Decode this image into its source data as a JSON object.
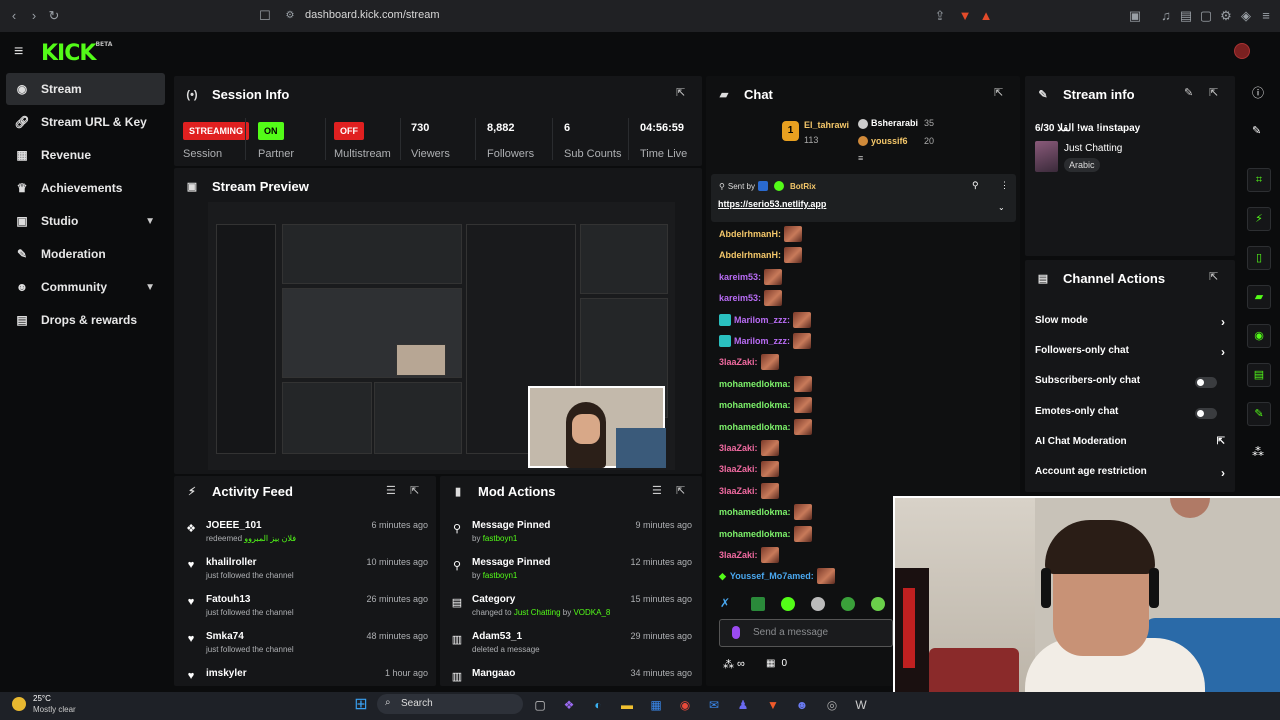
{
  "browser": {
    "url": "dashboard.kick.com/stream"
  },
  "logo": {
    "text": "KICK",
    "tag": "BETA"
  },
  "sidebar": {
    "items": [
      {
        "label": "Stream",
        "icon": "broadcast-icon"
      },
      {
        "label": "Stream URL & Key",
        "icon": "link-icon"
      },
      {
        "label": "Revenue",
        "icon": "revenue-icon"
      },
      {
        "label": "Achievements",
        "icon": "trophy-icon"
      },
      {
        "label": "Studio",
        "icon": "studio-icon"
      },
      {
        "label": "Moderation",
        "icon": "wrench-icon"
      },
      {
        "label": "Community",
        "icon": "community-icon"
      },
      {
        "label": "Drops & rewards",
        "icon": "gift-icon"
      }
    ]
  },
  "session": {
    "title": "Session Info",
    "status_badge": "STREAMING",
    "status_label": "Session",
    "partner_badge": "ON",
    "partner_label": "Partner",
    "multistream_badge": "OFF",
    "multistream_label": "Multistream",
    "viewers": "730",
    "viewers_label": "Viewers",
    "followers": "8,882",
    "followers_label": "Followers",
    "subs": "6",
    "subs_label": "Sub Counts",
    "time": "04:56:59",
    "time_label": "Time Live"
  },
  "preview": {
    "title": "Stream Preview"
  },
  "activity": {
    "title": "Activity Feed",
    "items": [
      {
        "name": "JOEEE_101",
        "sub": "redeemed",
        "reward": "فلان بيز المبروو",
        "time": "6 minutes ago"
      },
      {
        "name": "khalilroller",
        "sub": "just followed the channel",
        "time": "10 minutes ago"
      },
      {
        "name": "Fatouh13",
        "sub": "just followed the channel",
        "time": "26 minutes ago"
      },
      {
        "name": "Smka74",
        "sub": "just followed the channel",
        "time": "48 minutes ago"
      },
      {
        "name": "imskyler",
        "sub": "",
        "time": "1 hour ago"
      }
    ]
  },
  "modactions": {
    "title": "Mod Actions",
    "items": [
      {
        "name": "Message Pinned",
        "pre": "by",
        "by": "fastboyn1",
        "time": "9 minutes ago"
      },
      {
        "name": "Message Pinned",
        "pre": "by",
        "by": "fastboyn1",
        "time": "12 minutes ago"
      },
      {
        "name": "Category",
        "pre": "changed to",
        "cat": "Just Chatting",
        "by2": "by",
        "user": "VODKA_8",
        "time": "15 minutes ago"
      },
      {
        "name": "Adam53_1",
        "pre": "deleted a message",
        "time": "29 minutes ago"
      },
      {
        "name": "Mangaao",
        "pre": "",
        "time": "34 minutes ago"
      }
    ]
  },
  "chat": {
    "title": "Chat",
    "top": [
      {
        "name": "El_tahrawi",
        "count": "113"
      },
      {
        "name": "Bsherarabi",
        "count": "35"
      },
      {
        "name": "youssif6",
        "count": "20"
      }
    ],
    "pinned": {
      "sent_by": "Sent by",
      "bot": "BotRix",
      "link": "https://serio53.netlify.app"
    },
    "messages": [
      {
        "user": "AbdelrhmanH:",
        "color": "#f4c76a"
      },
      {
        "user": "AbdelrhmanH:",
        "color": "#f4c76a"
      },
      {
        "user": "kareim53:",
        "color": "#b86cf4"
      },
      {
        "user": "kareim53:",
        "color": "#b86cf4"
      },
      {
        "user": "Marilom_zzz:",
        "color": "#b86cf4"
      },
      {
        "user": "Marilom_zzz:",
        "color": "#b86cf4"
      },
      {
        "user": "3laaZaki:",
        "color": "#f06aa0"
      },
      {
        "user": "mohamedlokma:",
        "color": "#7cf06a"
      },
      {
        "user": "mohamedlokma:",
        "color": "#7cf06a"
      },
      {
        "user": "mohamedlokma:",
        "color": "#7cf06a"
      },
      {
        "user": "3laaZaki:",
        "color": "#f06aa0"
      },
      {
        "user": "3laaZaki:",
        "color": "#f06aa0"
      },
      {
        "user": "3laaZaki:",
        "color": "#f06aa0"
      },
      {
        "user": "mohamedlokma:",
        "color": "#7cf06a"
      },
      {
        "user": "mohamedlokma:",
        "color": "#7cf06a"
      },
      {
        "user": "3laaZaki:",
        "color": "#f06aa0"
      },
      {
        "user": "Youssef_Mo7amed:",
        "color": "#4aa8f0"
      }
    ],
    "placeholder": "Send a message",
    "viewers": "∞",
    "gift_count": "0"
  },
  "streaminfo": {
    "title": "Stream info",
    "stream_title": "6/30 القلا !wa !instapay",
    "category": "Just Chatting",
    "tag": "Arabic"
  },
  "actions": {
    "title": "Channel Actions",
    "items": [
      {
        "label": "Slow mode",
        "kind": "chevron"
      },
      {
        "label": "Followers-only chat",
        "kind": "chevron"
      },
      {
        "label": "Subscribers-only chat",
        "kind": "toggle"
      },
      {
        "label": "Emotes-only chat",
        "kind": "toggle"
      },
      {
        "label": "AI Chat Moderation",
        "kind": "external"
      },
      {
        "label": "Account age restriction",
        "kind": "chevron"
      }
    ]
  },
  "taskbar": {
    "temp": "25°C",
    "weather": "Mostly clear",
    "search": "Search"
  },
  "colors": {
    "accent": "#53fc18",
    "streaming": "#e02020",
    "bg": "#0b0c0d",
    "panel": "#151618"
  }
}
